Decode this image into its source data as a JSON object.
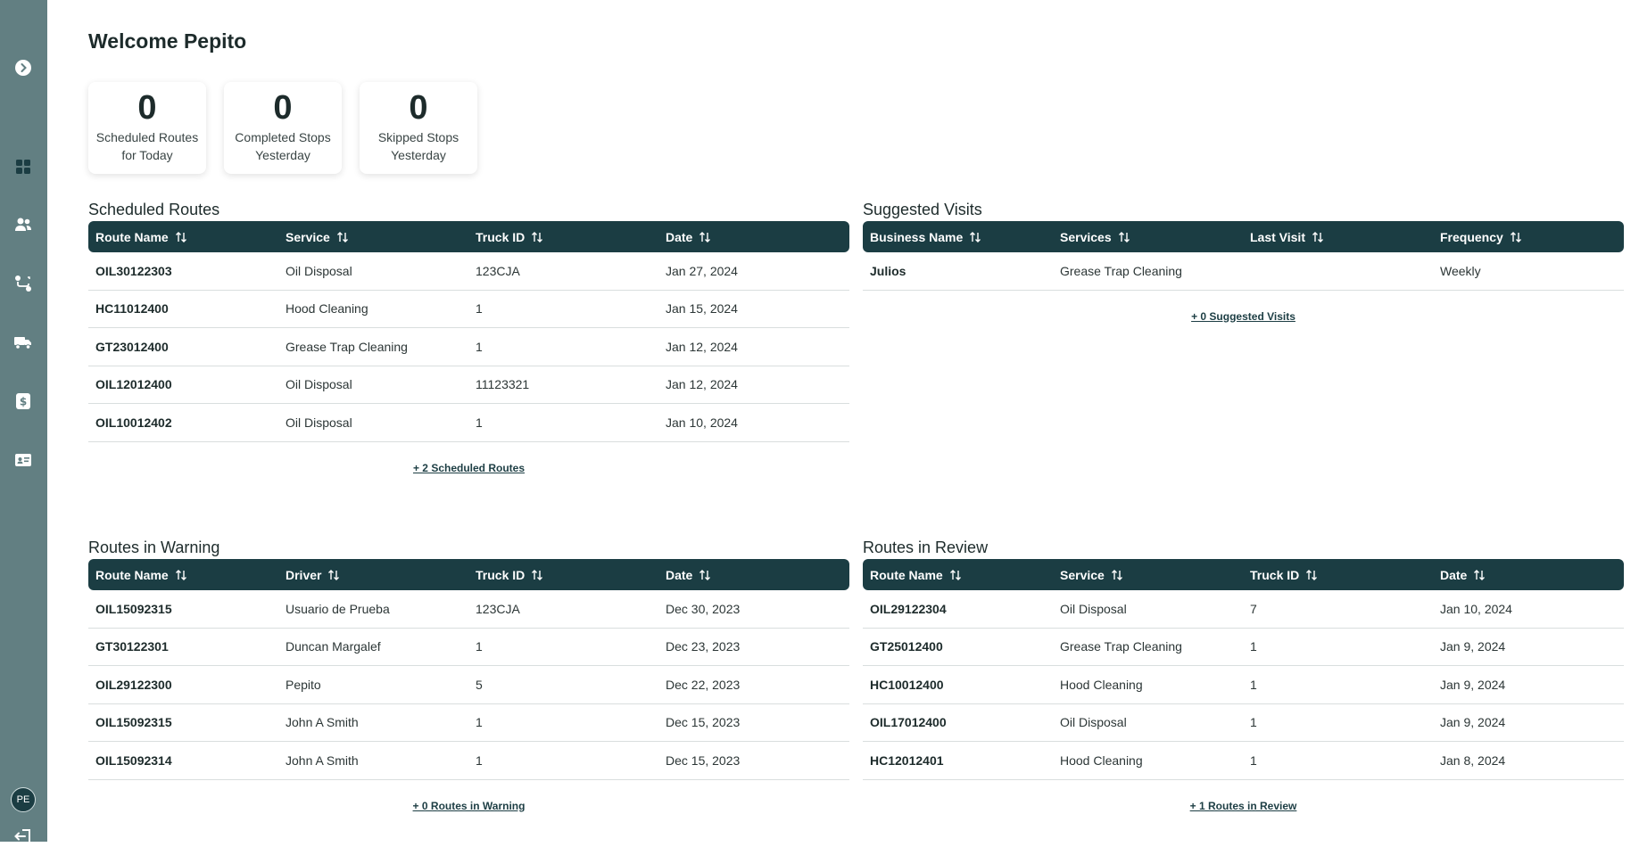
{
  "user": {
    "initials": "PE"
  },
  "welcome": "Welcome Pepito",
  "stats": [
    {
      "value": "0",
      "label_1": "Scheduled Routes",
      "label_2": "for Today"
    },
    {
      "value": "0",
      "label_1": "Completed Stops",
      "label_2": "Yesterday"
    },
    {
      "value": "0",
      "label_1": "Skipped Stops",
      "label_2": "Yesterday"
    }
  ],
  "scheduled_routes": {
    "title": "Scheduled Routes",
    "columns": [
      "Route Name",
      "Service",
      "Truck ID",
      "Date"
    ],
    "rows": [
      [
        "OIL30122303",
        "Oil Disposal",
        "123CJA",
        "Jan 27, 2024"
      ],
      [
        "HC11012400",
        "Hood Cleaning",
        "1",
        "Jan 15, 2024"
      ],
      [
        "GT23012400",
        "Grease Trap Cleaning",
        "1",
        "Jan 12, 2024"
      ],
      [
        "OIL12012400",
        "Oil Disposal",
        "11123321",
        "Jan 12, 2024"
      ],
      [
        "OIL10012402",
        "Oil Disposal",
        "1",
        "Jan 10, 2024"
      ]
    ],
    "more": "+ 2 Scheduled Routes"
  },
  "suggested_visits": {
    "title": "Suggested Visits",
    "columns": [
      "Business Name",
      "Services",
      "Last Visit",
      "Frequency"
    ],
    "rows": [
      [
        "Julios",
        "Grease Trap Cleaning",
        "",
        "Weekly"
      ]
    ],
    "more": "+ 0 Suggested Visits"
  },
  "routes_warning": {
    "title": "Routes in Warning",
    "columns": [
      "Route Name",
      "Driver",
      "Truck ID",
      "Date"
    ],
    "rows": [
      [
        "OIL15092315",
        "Usuario de Prueba",
        "123CJA",
        "Dec 30, 2023"
      ],
      [
        "GT30122301",
        "Duncan Margalef",
        "1",
        "Dec 23, 2023"
      ],
      [
        "OIL29122300",
        "Pepito",
        "5",
        "Dec 22, 2023"
      ],
      [
        "OIL15092315",
        "John A Smith",
        "1",
        "Dec 15, 2023"
      ],
      [
        "OIL15092314",
        "John A Smith",
        "1",
        "Dec 15, 2023"
      ]
    ],
    "more": "+ 0 Routes in Warning"
  },
  "routes_review": {
    "title": "Routes in Review",
    "columns": [
      "Route Name",
      "Service",
      "Truck ID",
      "Date"
    ],
    "rows": [
      [
        "OIL29122304",
        "Oil Disposal",
        "7",
        "Jan 10, 2024"
      ],
      [
        "GT25012400",
        "Grease Trap Cleaning",
        "1",
        "Jan 9, 2024"
      ],
      [
        "HC10012400",
        "Hood Cleaning",
        "1",
        "Jan 9, 2024"
      ],
      [
        "OIL17012400",
        "Oil Disposal",
        "1",
        "Jan 9, 2024"
      ],
      [
        "HC12012401",
        "Hood Cleaning",
        "1",
        "Jan 8, 2024"
      ]
    ],
    "more": "+ 1 Routes in Review"
  },
  "colors": {
    "sidebar": "#627f82",
    "header": "#1b3d43",
    "accent": "#1d3e44"
  }
}
